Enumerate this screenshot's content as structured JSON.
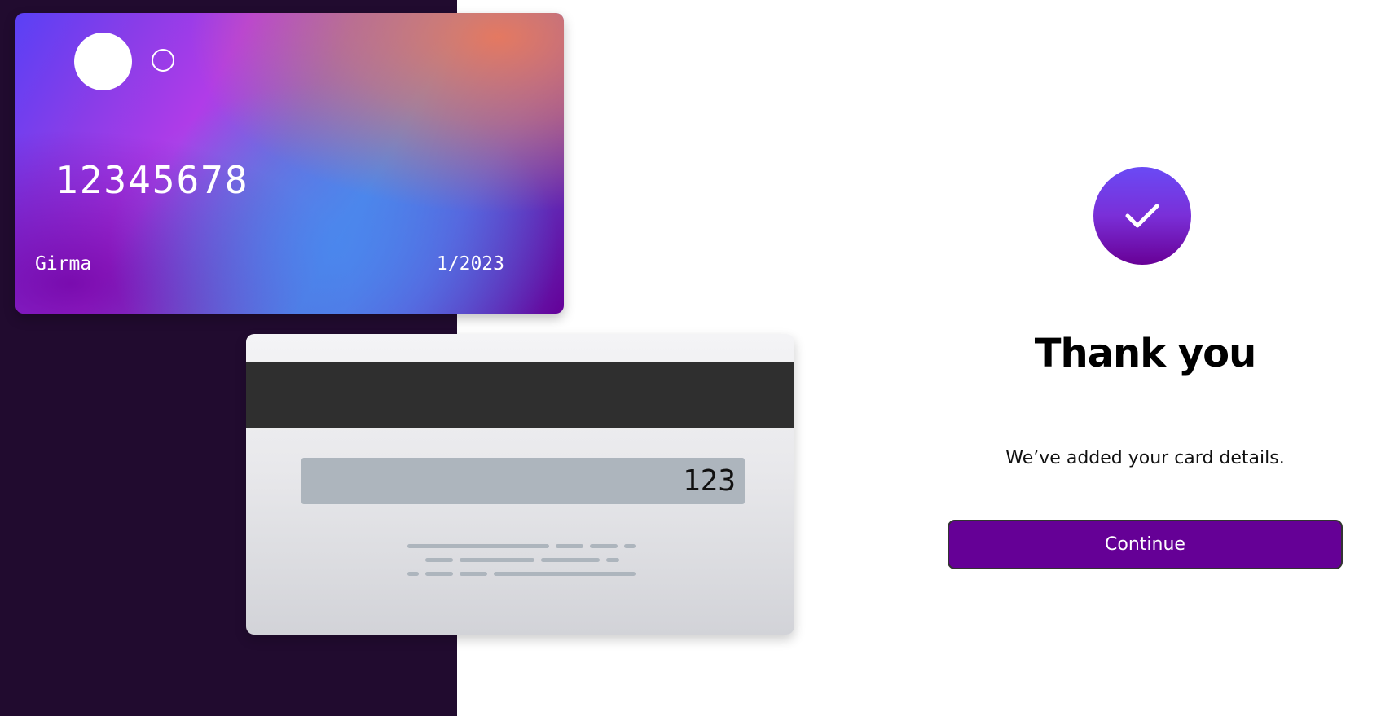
{
  "card_front": {
    "number": "12345678",
    "name": "Girma",
    "expiry": "1/2023"
  },
  "card_back": {
    "cvc": "123"
  },
  "confirmation": {
    "icon": "check-icon",
    "title": "Thank you",
    "message": "We’ve added your card details.",
    "continue_label": "Continue"
  },
  "colors": {
    "left_panel_bg": "#210b2f",
    "button_bg": "#650096",
    "badge_bottom": "#680096",
    "badge_top": "#6a4af5"
  }
}
